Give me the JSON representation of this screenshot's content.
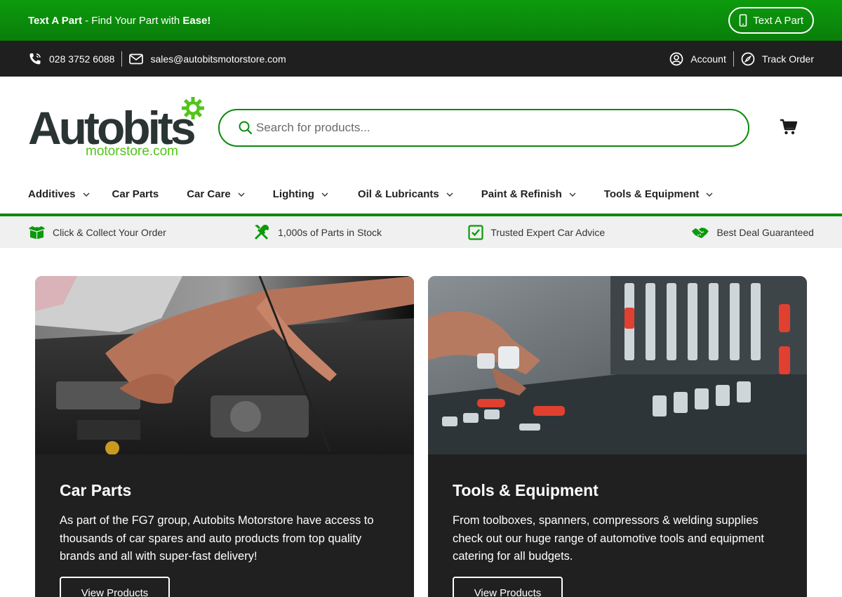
{
  "promo": {
    "text_bold_1": "Text A Part",
    "text_mid": " - Find Your Part with ",
    "text_bold_2": "Ease!",
    "button_label": "Text A Part"
  },
  "contact": {
    "phone": "028 3752 6088",
    "email": "sales@autobitsmotorstore.com",
    "account_label": "Account",
    "track_label": "Track Order"
  },
  "logo": {
    "main": "Autobits",
    "sub": "motorstore.com"
  },
  "search": {
    "placeholder": "Search for products..."
  },
  "nav": [
    {
      "label": "Additives",
      "dropdown": true
    },
    {
      "label": "Car Parts",
      "dropdown": false
    },
    {
      "label": "Car Care",
      "dropdown": true
    },
    {
      "label": "Lighting",
      "dropdown": true
    },
    {
      "label": "Oil & Lubricants",
      "dropdown": true
    },
    {
      "label": "Paint & Refinish",
      "dropdown": true
    },
    {
      "label": "Tools & Equipment",
      "dropdown": true
    }
  ],
  "usp": [
    {
      "label": "Click & Collect Your Order",
      "icon": "box-icon"
    },
    {
      "label": "1,000s of Parts in Stock",
      "icon": "tools-icon"
    },
    {
      "label": "Trusted Expert Car Advice",
      "icon": "check-icon"
    },
    {
      "label": "Best Deal Guaranteed",
      "icon": "handshake-icon"
    }
  ],
  "cards": [
    {
      "title": "Car Parts",
      "description": "As part of the FG7 group, Autobits Motorstore have access to thousands of car spares and auto products from top quality brands and all with super-fast delivery!",
      "button": "View Products"
    },
    {
      "title": "Tools & Equipment",
      "description": "From toolboxes, spanners, compressors & welding supplies check out our huge range of automotive tools and equipment catering for all budgets.",
      "button": "View Products"
    }
  ],
  "colors": {
    "brand_green": "#0a8a0a",
    "dark_bar": "#1f1f1f",
    "card_bg": "#202020",
    "logo_dark": "#2b3434",
    "logo_light_green": "#52c41a"
  }
}
